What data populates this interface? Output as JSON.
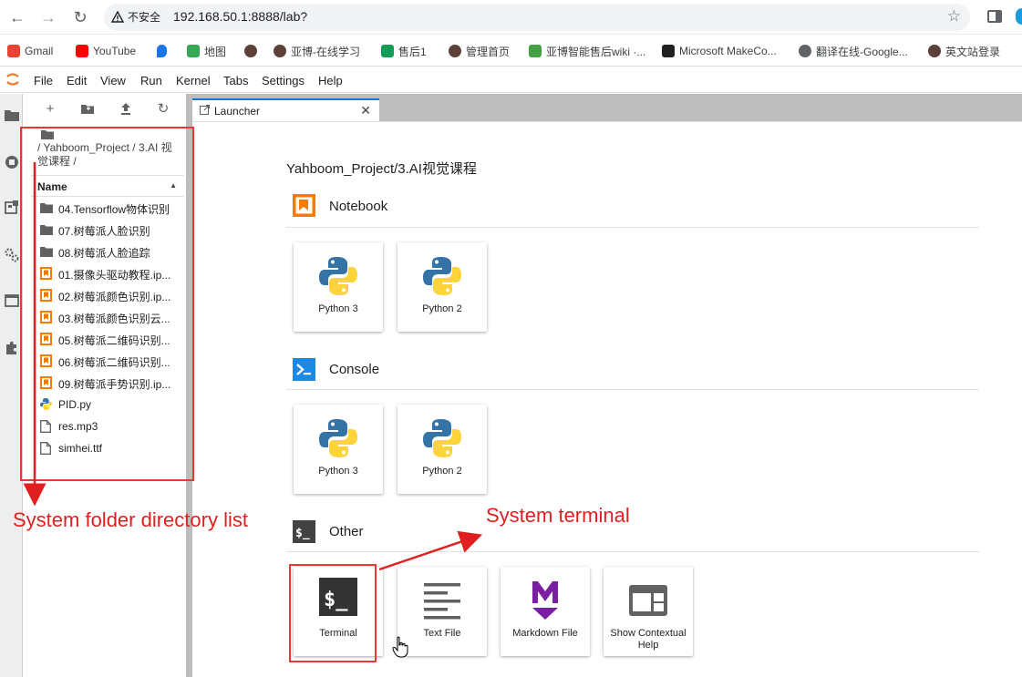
{
  "browser": {
    "security_label": "不安全",
    "url": "192.168.50.1:8888/lab?",
    "bookmarks": [
      {
        "label": "Gmail",
        "icon": "gmail-icon",
        "color": "#ea4335"
      },
      {
        "label": "YouTube",
        "icon": "youtube-icon",
        "color": "#ff0000"
      },
      {
        "label": "",
        "icon": "location-pin-icon",
        "color": "#1a73e8"
      },
      {
        "label": "地图",
        "icon": "maps-icon",
        "color": "#34a853"
      },
      {
        "label": "",
        "icon": "yahboom-icon",
        "color": "#5d4037"
      },
      {
        "label": "亚博-在线学习",
        "icon": "yahboom-icon",
        "color": "#5d4037"
      },
      {
        "label": "售后1",
        "icon": "sheets-icon",
        "color": "#0f9d58"
      },
      {
        "label": "管理首页",
        "icon": "yahboom-icon",
        "color": "#5d4037"
      },
      {
        "label": "亚博智能售后wiki ·...",
        "icon": "leaf-icon",
        "color": "#43a047"
      },
      {
        "label": "Microsoft MakeCo...",
        "icon": "makecode-icon",
        "color": "#212121"
      },
      {
        "label": "翻译在线-Google...",
        "icon": "globe-icon",
        "color": "#5f6368"
      },
      {
        "label": "英文站登录",
        "icon": "yahboom-icon",
        "color": "#5d4037"
      }
    ]
  },
  "menubar": {
    "items": [
      "File",
      "Edit",
      "View",
      "Run",
      "Kernel",
      "Tabs",
      "Settings",
      "Help"
    ]
  },
  "filebrowser": {
    "breadcrumb": "/ Yahboom_Project / 3.AI 视觉课程 /",
    "column_header": "Name",
    "files": [
      {
        "name": "04.Tensorflow物体识别",
        "type": "folder"
      },
      {
        "name": "07.树莓派人脸识别",
        "type": "folder"
      },
      {
        "name": "08.树莓派人脸追踪",
        "type": "folder"
      },
      {
        "name": "01.摄像头驱动教程.ip...",
        "type": "notebook"
      },
      {
        "name": "02.树莓派颜色识别.ip...",
        "type": "notebook"
      },
      {
        "name": "03.树莓派颜色识别云...",
        "type": "notebook"
      },
      {
        "name": "05.树莓派二维码识别...",
        "type": "notebook"
      },
      {
        "name": "06.树莓派二维码识别...",
        "type": "notebook"
      },
      {
        "name": "09.树莓派手势识别.ip...",
        "type": "notebook"
      },
      {
        "name": "PID.py",
        "type": "python"
      },
      {
        "name": "res.mp3",
        "type": "file"
      },
      {
        "name": "simhei.ttf",
        "type": "file"
      }
    ]
  },
  "tabs": [
    {
      "label": "Launcher"
    }
  ],
  "launcher": {
    "cwd": "Yahboom_Project/3.AI视觉课程",
    "sections": {
      "notebook": {
        "title": "Notebook",
        "cards": [
          "Python 3",
          "Python 2"
        ]
      },
      "console": {
        "title": "Console",
        "cards": [
          "Python 3",
          "Python 2"
        ]
      },
      "other": {
        "title": "Other",
        "cards": [
          "Terminal",
          "Text File",
          "Markdown File",
          "Show Contextual Help"
        ]
      }
    }
  },
  "annotations": {
    "folder_list": "System folder directory list",
    "terminal": "System terminal",
    "color": "#e02020"
  },
  "colors": {
    "accent": "#1976d2",
    "notebook_orange": "#f57c00",
    "console_blue": "#1e88e5",
    "markdown_purple": "#7b1fa2"
  }
}
